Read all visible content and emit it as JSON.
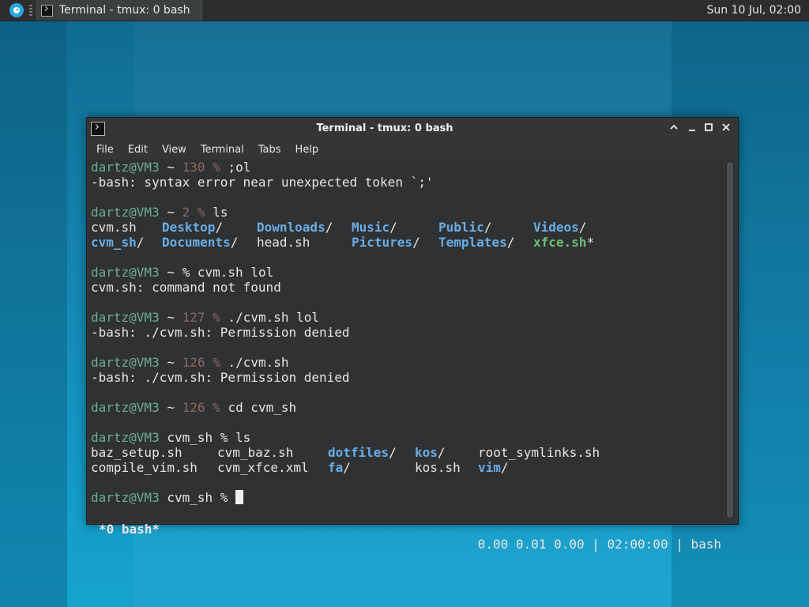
{
  "panel": {
    "task_title": "Terminal - tmux: 0 bash",
    "clock": "Sun 10 Jul, 02:00"
  },
  "window": {
    "title": "Terminal - tmux: 0 bash",
    "menu": [
      "File",
      "Edit",
      "View",
      "Terminal",
      "Tabs",
      "Help"
    ]
  },
  "terminal": {
    "prompt_user": "dartz@VM3",
    "lines": [
      {
        "dir": "~",
        "code": "130",
        "cmd": ";ol"
      },
      {
        "text": "-bash: syntax error near unexpected token `;'"
      },
      {
        "dir": "~",
        "code": "2",
        "cmd": "ls"
      },
      {
        "ls1": [
          [
            "cvm.sh",
            "plain"
          ],
          [
            "Desktop",
            "dir"
          ],
          [
            "Downloads",
            "dir"
          ],
          [
            "Music",
            "dir"
          ],
          [
            "Public",
            "dir"
          ],
          [
            "Videos",
            "dir"
          ]
        ]
      },
      {
        "ls2": [
          [
            "cvm_sh",
            "dir"
          ],
          [
            "Documents",
            "dir"
          ],
          [
            "head.sh",
            "plain"
          ],
          [
            "Pictures",
            "dir"
          ],
          [
            "Templates",
            "dir"
          ],
          [
            "xfce.sh",
            "exec"
          ]
        ]
      },
      {
        "dir": "~",
        "code": "",
        "cmd": "cvm.sh lol"
      },
      {
        "text": "cvm.sh: command not found"
      },
      {
        "dir": "~",
        "code": "127",
        "cmd": "./cvm.sh lol"
      },
      {
        "text": "-bash: ./cvm.sh: Permission denied"
      },
      {
        "dir": "~",
        "code": "126",
        "cmd": "./cvm.sh"
      },
      {
        "text": "-bash: ./cvm.sh: Permission denied"
      },
      {
        "dir": "~",
        "code": "126",
        "cmd": "cd cvm_sh"
      },
      {
        "dir": "cvm_sh",
        "code": "",
        "cmd": "ls"
      },
      {
        "ls3": [
          [
            "baz_setup.sh",
            "plain"
          ],
          [
            "cvm_baz.sh",
            "plain"
          ],
          [
            "dotfiles",
            "dir"
          ],
          [
            "kos",
            "dir"
          ],
          [
            "root_symlinks.sh",
            "plain"
          ]
        ]
      },
      {
        "ls4": [
          [
            "compile_vim.sh",
            "plain"
          ],
          [
            "cvm_xfce.xml",
            "plain"
          ],
          [
            "fa",
            "dir"
          ],
          [
            "kos.sh",
            "plain"
          ],
          [
            "vim",
            "dir"
          ]
        ]
      },
      {
        "dir": "cvm_sh",
        "code": "",
        "cmd": ""
      }
    ],
    "status_left": "*0 bash*",
    "status_right": "0.00 0.01 0.00 | 02:00:00 | bash"
  },
  "colors": {
    "desktop": "#1483ad",
    "panel": "#2b2d2e",
    "window": "#333536",
    "prompt": "#6fae8f",
    "exit_code": "#8c6a63",
    "directory": "#6aaee6",
    "executable": "#6fbf6f"
  },
  "icons": {
    "app_menu": "whisker-menu-icon",
    "terminal": "terminal-icon"
  }
}
